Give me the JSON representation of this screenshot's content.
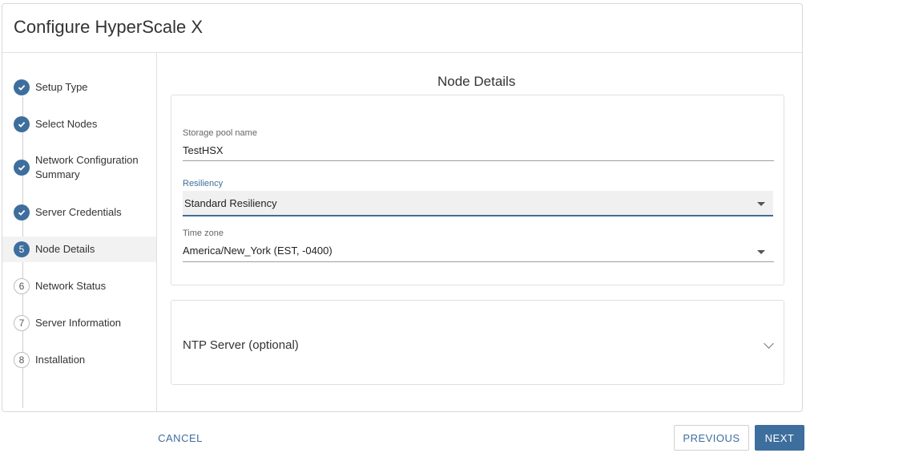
{
  "dialog": {
    "title": "Configure HyperScale X"
  },
  "steps": [
    {
      "marker": "",
      "label": "Setup Type",
      "status": "done"
    },
    {
      "marker": "",
      "label": "Select Nodes",
      "status": "done"
    },
    {
      "marker": "",
      "label": "Network Configuration Summary",
      "status": "done"
    },
    {
      "marker": "",
      "label": "Server Credentials",
      "status": "done"
    },
    {
      "marker": "5",
      "label": "Node Details",
      "status": "current"
    },
    {
      "marker": "6",
      "label": "Network Status",
      "status": "pending"
    },
    {
      "marker": "7",
      "label": "Server Information",
      "status": "pending"
    },
    {
      "marker": "8",
      "label": "Installation",
      "status": "pending"
    }
  ],
  "main": {
    "title": "Node Details",
    "storage_pool": {
      "label": "Storage pool name",
      "value": "TestHSX"
    },
    "resiliency": {
      "label": "Resiliency",
      "value": "Standard Resiliency"
    },
    "time_zone": {
      "label": "Time zone",
      "value": "America/New_York (EST, -0400)"
    },
    "ntp": {
      "label": "NTP Server (optional)"
    }
  },
  "footer": {
    "cancel_label": "CANCEL",
    "previous_label": "PREVIOUS",
    "next_label": "NEXT"
  },
  "colors": {
    "accent": "#3e6e9d",
    "accent_text": "#3e6e9d"
  }
}
